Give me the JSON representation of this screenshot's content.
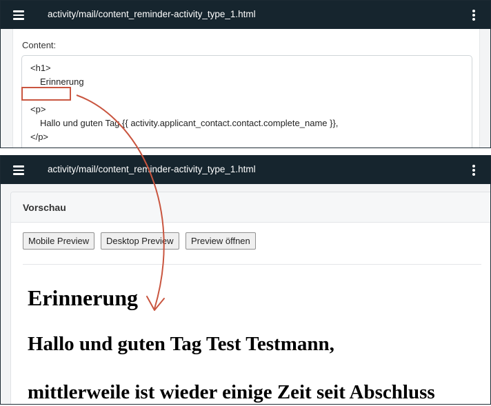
{
  "top_panel": {
    "path": "activity/mail/content_reminder-activity_type_1.html",
    "content_label": "Content:",
    "code_lines": [
      "<h1>",
      "Erinnerung",
      "<p>",
      "Hallo und guten Tag {{ activity.applicant_contact.contact.complete_name }},",
      "</p>"
    ]
  },
  "bottom_panel": {
    "path": "activity/mail/content_reminder-activity_type_1.html",
    "preview_title": "Vorschau",
    "buttons": {
      "mobile": "Mobile Preview",
      "desktop": "Desktop Preview",
      "open": "Preview öffnen"
    },
    "rendered": {
      "heading": "Erinnerung",
      "greeting": "Hallo und guten Tag Test Testmann,",
      "body": "mittlerweile ist wieder einige Zeit seit Abschluss"
    }
  },
  "colors": {
    "topbar": "#16252e",
    "annotation": "#c9553f"
  },
  "icons": [
    "menu-icon",
    "kebab-menu-icon"
  ]
}
